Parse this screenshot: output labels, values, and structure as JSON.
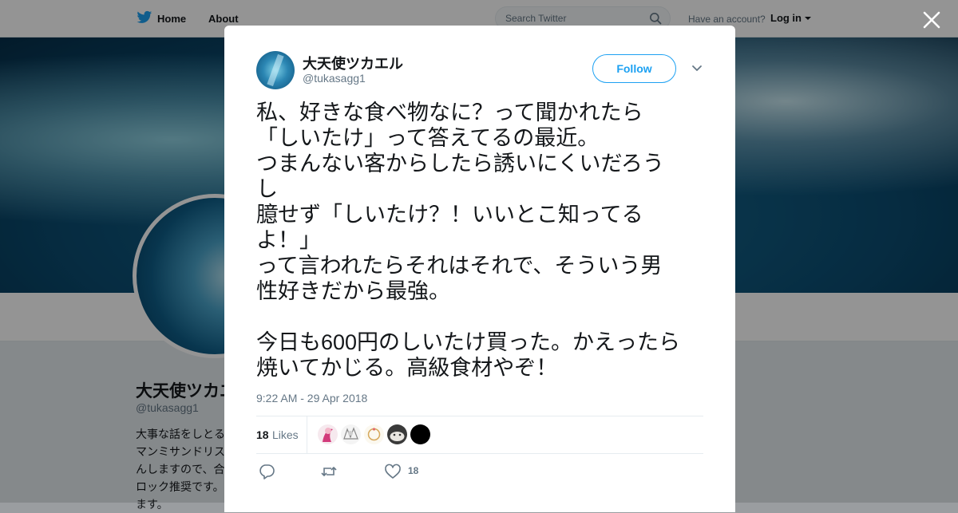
{
  "nav": {
    "home_label": "Home",
    "about_label": "About",
    "search_placeholder": "Search Twitter",
    "have_account": "Have an account?",
    "login_label": "Log in"
  },
  "profile": {
    "name": "大天使ツカエ",
    "handle": "@tukasagg1",
    "bio_lines": [
      "大事な話をしとる",
      "マンミサンドリス",
      "んしますので、合",
      "ロック推奨です。",
      "ます。"
    ]
  },
  "tweet": {
    "author_name": "大天使ツカエル",
    "author_handle": "@tukasagg1",
    "follow_label": "Follow",
    "text_lines": [
      "私、好きな食べ物なに？って聞かれたら",
      "「しいたけ」って答えてるの最近。",
      "つまんない客からしたら誘いにくいだろう",
      "し",
      "臆せず「しいたけ？！いいとこ知ってる",
      "よ！」",
      "って言われたらそれはそれで、そういう男",
      "性好きだから最強。",
      "",
      "今日も600円のしいたけ買った。かえったら",
      "焼いてかじる。高級食材やぞ！"
    ],
    "timestamp": "9:22 AM - 29 Apr 2018",
    "likes_count": "18",
    "likes_label": "Likes",
    "like_action_count": "18"
  },
  "colors": {
    "accent": "#1da1f2",
    "text_primary": "#14171a",
    "text_secondary": "#657786"
  },
  "icons": {
    "nav_logo": "twitter-bird-icon",
    "search": "search-icon",
    "close": "close-icon",
    "more": "chevron-down-icon",
    "reply": "reply-icon",
    "retweet": "retweet-icon",
    "like": "heart-icon"
  }
}
